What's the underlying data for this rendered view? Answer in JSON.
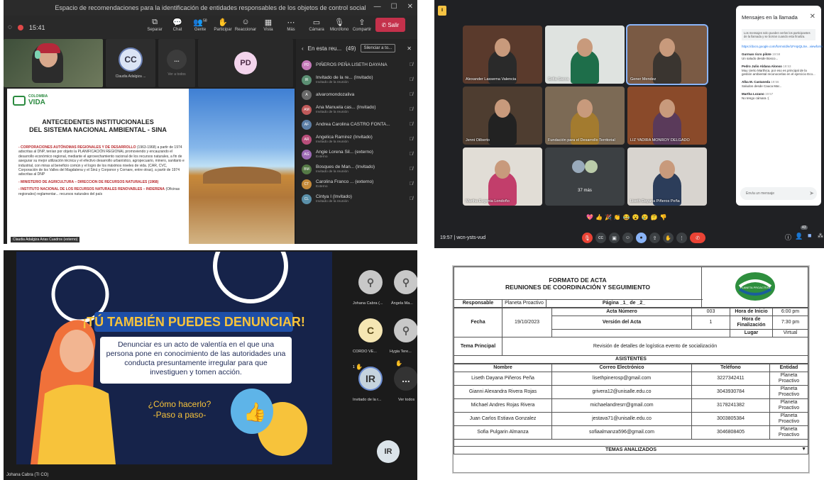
{
  "teams1": {
    "window_title": "Espacio de recomendaciones para la identificación de entidades responsables de los objetos de control social",
    "time": "15:41",
    "toolbar": [
      {
        "label": "Separar",
        "icon": "separate-icon"
      },
      {
        "label": "Chat",
        "icon": "chat-icon"
      },
      {
        "label": "Gente",
        "icon": "people-icon",
        "count": "58"
      },
      {
        "label": "Participar",
        "icon": "raise-hand-icon"
      },
      {
        "label": "Reaccionar",
        "icon": "react-icon"
      },
      {
        "label": "Vista",
        "icon": "view-icon"
      },
      {
        "label": "Más",
        "icon": "more-icon"
      }
    ],
    "controls": [
      {
        "label": "Cámara",
        "icon": "camera-icon"
      },
      {
        "label": "Micrófono",
        "icon": "mic-icon"
      },
      {
        "label": "Compartir",
        "icon": "share-icon"
      }
    ],
    "leave_label": "Salir",
    "tiles": [
      {
        "initials": "CC",
        "name": "Claudia Adalgiza ..."
      },
      {
        "initials": "...",
        "name": "Ver a todos"
      },
      {
        "initials": "PD",
        "name": ""
      }
    ],
    "slide": {
      "brand_line1": "COLOMBIA",
      "brand_line2": "VIDA",
      "title_line1": "ANTECEDENTES INSTITUCIONALES",
      "title_line2": "DEL SISTEMA NACIONAL AMBIENTAL - SINA",
      "p1_head": "- CORPORACIONES AUTÓNOMAS REGIONALES Y DE DESARROLLO",
      "p1_body": "(1963-1968) a partir de 1974 adscritas al DNP, tenían por objeto la PLANIFICACIÓN REGIONAL promoviendo y encauzando el desarrollo económico regional, mediante el aprovechamiento racional de los recursos naturales, a fin de asegurar su mejor utilización técnica y el efectivo desarrollo urbanístico, agropecuario, minero, sanitario e industrial, con miras al beneficio común y el logro de los máximos niveles de vida. (CAR, CVC, Corporación de los Valles del Magdalena y el Sinú y Corponor y Cornare, entre otras), a partir de 1974 adscritas al DNP",
      "p2_head": "- MINISTERIO DE AGRICULTURA – DIRECCION DE RECURSOS NATURALES (1968)",
      "p3_head": "- INSTITUTO NACIONAL DE LOS RECURSOS NATURALES RENOVABLES – INDERENA",
      "p3_body": "(Oficinas regionales) reglamentar... recursos naturales del país",
      "share_caption": "Claudia Adalgiza Arias Cuadros (externo)"
    },
    "panel": {
      "title": "En esta reu...",
      "count": "(49)",
      "mute_all": "Silenciar a to...",
      "participants": [
        {
          "initials": "PD",
          "name": "PIÑEROS PEÑA LISETH DAYANA",
          "sub": "",
          "color": "#c47ab9"
        },
        {
          "initials": "IR",
          "name": "Invitado de la re... (Invitado)",
          "sub": "Invitado de la reunión",
          "color": "#5b8f73"
        },
        {
          "initials": "A",
          "name": "alvaromondozaliva",
          "sub": "",
          "color": "#6a6a6a"
        },
        {
          "initials": "AM",
          "name": "Ana Manuela cas... (Invitado)",
          "sub": "Invitado de la reunión",
          "color": "#c05a5a"
        },
        {
          "initials": "AF",
          "name": "Andrea Carolina CASTRO FONTA...",
          "sub": "",
          "color": "#5d7fa6"
        },
        {
          "initials": "AR",
          "name": "Angelica Ramirez (Invitado)",
          "sub": "Invitado de la reunión",
          "color": "#b84e7a"
        },
        {
          "initials": "AG",
          "name": "Angie Lorena Sil... (externo)",
          "sub": "Externo",
          "color": "#9d6bb5"
        },
        {
          "initials": "BM",
          "name": "Bosques de Man... (Invitado)",
          "sub": "Invitado de la reunión",
          "color": "#557a46"
        },
        {
          "initials": "CT",
          "name": "Carolina Franco ... (externo)",
          "sub": "Externo",
          "color": "#c58a3a"
        },
        {
          "initials": "CL",
          "name": "Cintya I (Invitado)",
          "sub": "Invitado de la reunión",
          "color": "#5a8fa8"
        }
      ]
    }
  },
  "meet": {
    "tiles": [
      {
        "name": "Alexander Lasserna Valencia"
      },
      {
        "name": "Sofia Sacca"
      },
      {
        "name": "Gener Mendez"
      },
      {
        "name": "Jenni Oilberto"
      },
      {
        "name": "Fundación para el Desarrollo Territorial"
      },
      {
        "name": "LIZ YADIRA MONROY DELGADO"
      },
      {
        "name": "Martha Eugenia Londoño"
      },
      {
        "name": "37 más"
      },
      {
        "name": "Liseth Dayana Piñeros Peña"
      }
    ],
    "chat": {
      "title": "Mensajes en la llamada",
      "note": "Los mensajes solo pueden verlos los participantes de la llamada y se borran cuando esta finaliza.",
      "link_text": "https://docs.google.com/forms/d/e/1FAIpQLSe...viewform",
      "messages": [
        {
          "who": "Gurman ricro pilote",
          "time": "19:59",
          "text": "Un saludo desde Bosco..."
        },
        {
          "who": "Pedro Julio Aldana Alonso",
          "time": "19:53",
          "text": "Muy cierto Marthica, por eso es principal de la gestión ambiental reconocerlas en el ejercicio Eco..."
        },
        {
          "who": "Alba M. Castaneda",
          "time": "19:56",
          "text": "Saludos desde Cauca Mar..."
        },
        {
          "who": "Martha Lozano",
          "time": "19:57",
          "text": "No tengo cámara :("
        }
      ],
      "input_placeholder": "Envía un mensaje"
    },
    "time_code": "19:57",
    "meeting_code": "wcn-ysts-vud",
    "badge_count": "43",
    "reactions": [
      "💖",
      "👍",
      "🎉",
      "👏",
      "😂",
      "😮",
      "😢",
      "🤔",
      "👎"
    ]
  },
  "teams3": {
    "slide": {
      "headline": "¡TÚ TAMBIÉN PUEDES DENUNCIAR!",
      "body": "Denunciar es un acto de valentía en el que una persona pone en conocimiento de las autoridades una conducta presuntamente irregular para que investiguen y tomen acción.",
      "howto_line1": "¿Cómo hacerlo?",
      "howto_line2": "-Paso a paso-"
    },
    "caption": "Johana Cabra (TI CO)",
    "side": [
      {
        "initials": "",
        "name": "Johana Cabra (..."
      },
      {
        "initials": "",
        "name": "Ángela Ma..."
      },
      {
        "initials": "C",
        "name": "CORDO VE..."
      },
      {
        "initials": "",
        "name": "Hygia Tere..."
      },
      {
        "initials": "IR",
        "name": "Invitado de la r..."
      },
      {
        "initials": "...",
        "name": "Ver todos"
      },
      {
        "initials": "IR",
        "name": ""
      }
    ],
    "raised_hand_count": "1"
  },
  "acta": {
    "title_line1": "FORMATO DE ACTA",
    "title_line2": "REUNIONES DE COORDINACIÓN Y SEGUIMIENTO",
    "logo_text": "PLANETA PROACTIVO",
    "responsable_label": "Responsable",
    "responsable_value": "Planeta Proactivo",
    "pagina": "Página _1_ de _2_",
    "fecha_label": "Fecha",
    "fecha_value": "19/10/2023",
    "acta_numero_label": "Acta Número",
    "acta_numero_value": "003",
    "version_label": "Versión del Acta",
    "version_value": "1",
    "hora_inicio_label": "Hora de Inicio",
    "hora_inicio_value": "6:00 pm",
    "hora_fin_label": "Hora de Finalización",
    "hora_fin_value": "7:30 pm",
    "lugar_label": "Lugar",
    "lugar_value": "Virtual",
    "tema_label": "Tema Principal",
    "tema_value": "Revisión de detalles de logística evento de socialización",
    "asistentes_label": "ASISTENTES",
    "headers": [
      "Nombre",
      "Correo Electrónico",
      "Teléfono",
      "Entidad"
    ],
    "rows": [
      [
        "Liseth Dayana Piñeros Peña",
        "lisethpinerosp@gmail.com",
        "3227342411",
        "Planeta Proactivo"
      ],
      [
        "Gianni Alexandra Rivera Rojas",
        "grivera12@unisalle.edu.co",
        "3043930784",
        "Planeta Proactivo"
      ],
      [
        "Michael Andres Rojas Rivera",
        "michaelandresrr@gmail.com",
        "3178241382",
        "Planeta Proactivo"
      ],
      [
        "Juan Carlos Estiava Gonzalez",
        "jestava71@unisalle.edu.co",
        "3003805384",
        "Planeta Proactivo"
      ],
      [
        "Sofia Pulgarin Almanza",
        "sofiaalmanza596@gmail.com",
        "3046808405",
        "Planeta Proactivo"
      ]
    ],
    "temas_label": "TEMAS ANALIZADOS"
  }
}
